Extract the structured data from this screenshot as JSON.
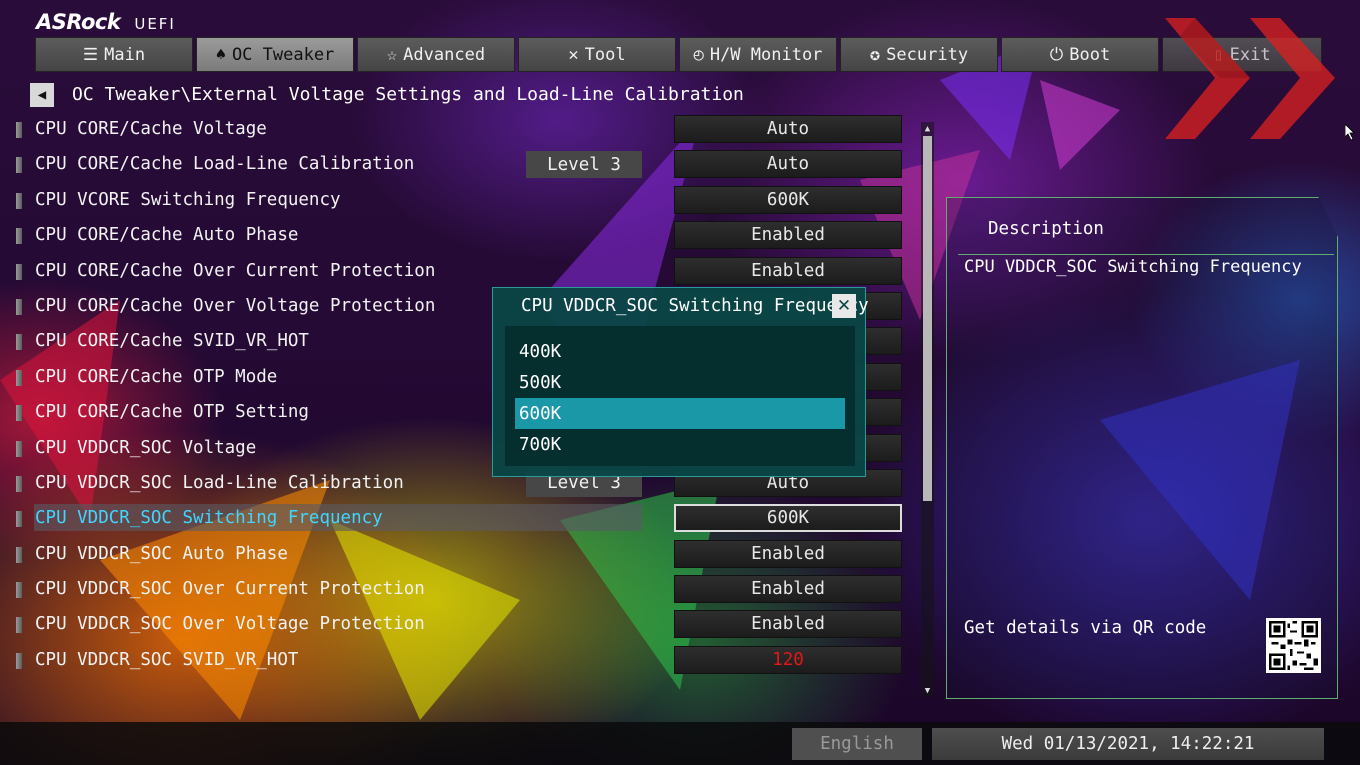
{
  "header": {
    "brand": "ASRock",
    "sub": "UEFI",
    "tabs": [
      {
        "label": "Main",
        "icon": "list-icon"
      },
      {
        "label": "OC Tweaker",
        "icon": "rocket-icon"
      },
      {
        "label": "Advanced",
        "icon": "star-icon"
      },
      {
        "label": "Tool",
        "icon": "wrench-icon"
      },
      {
        "label": "H/W Monitor",
        "icon": "monitor-icon"
      },
      {
        "label": "Security",
        "icon": "shield-icon"
      },
      {
        "label": "Boot",
        "icon": "power-icon"
      },
      {
        "label": "Exit",
        "icon": "exit-icon"
      }
    ],
    "active_tab": "OC Tweaker"
  },
  "breadcrumb": "OC Tweaker\\External Voltage Settings and Load-Line Calibration",
  "settings": [
    {
      "label": "CPU CORE/Cache Voltage",
      "level": "",
      "value": "Auto"
    },
    {
      "label": "CPU CORE/Cache Load-Line Calibration",
      "level": "Level 3",
      "value": "Auto"
    },
    {
      "label": "CPU VCORE Switching Frequency",
      "level": "",
      "value": "600K"
    },
    {
      "label": "CPU CORE/Cache Auto Phase",
      "level": "",
      "value": "Enabled"
    },
    {
      "label": "CPU CORE/Cache Over Current Protection",
      "level": "",
      "value": "Enabled"
    },
    {
      "label": "CPU CORE/Cache Over Voltage Protection",
      "level": "",
      "value": ""
    },
    {
      "label": "CPU CORE/Cache SVID_VR_HOT",
      "level": "",
      "value": ""
    },
    {
      "label": "CPU CORE/Cache OTP Mode",
      "level": "",
      "value": ""
    },
    {
      "label": "CPU CORE/Cache OTP Setting",
      "level": "",
      "value": ""
    },
    {
      "label": "CPU VDDCR_SOC Voltage",
      "level": "",
      "value": ""
    },
    {
      "label": "CPU VDDCR_SOC Load-Line Calibration",
      "level": "Level 3",
      "value": "Auto"
    },
    {
      "label": "CPU VDDCR_SOC Switching Frequency",
      "level": "",
      "value": "600K"
    },
    {
      "label": "CPU VDDCR_SOC Auto Phase",
      "level": "",
      "value": "Enabled"
    },
    {
      "label": "CPU VDDCR_SOC Over Current Protection",
      "level": "",
      "value": "Enabled"
    },
    {
      "label": "CPU VDDCR_SOC Over Voltage Protection",
      "level": "",
      "value": "Enabled"
    },
    {
      "label": "CPU VDDCR_SOC SVID_VR_HOT",
      "level": "",
      "value": "120"
    }
  ],
  "selected_setting": "CPU VDDCR_SOC Switching Frequency",
  "popup": {
    "title": "CPU VDDCR_SOC Switching Frequency",
    "options": [
      "400K",
      "500K",
      "600K",
      "700K"
    ],
    "selected": "600K"
  },
  "description": {
    "title": "Description",
    "text": "CPU VDDCR_SOC Switching Frequency",
    "qr_label": "Get details via QR code"
  },
  "footer": {
    "language": "English",
    "datetime": "Wed 01/13/2021, 14:22:21"
  },
  "colors": {
    "selected_text": "#3fd6ff",
    "popup_highlight": "#1b98a8",
    "warning_value": "#e01818",
    "panel_border": "#5fae6f"
  }
}
